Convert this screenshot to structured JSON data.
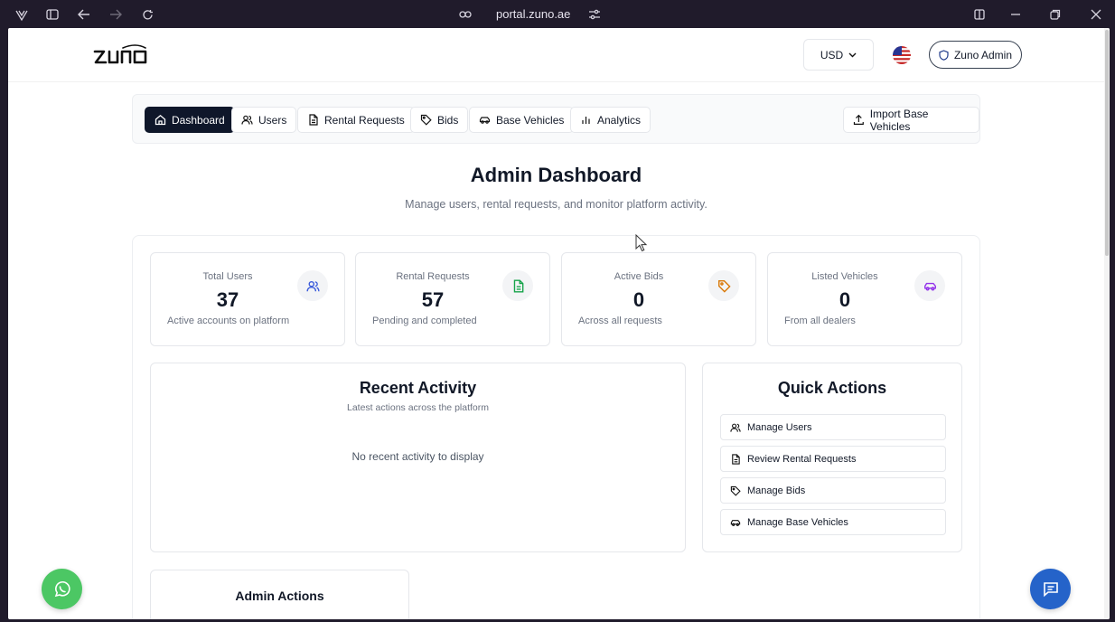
{
  "browser": {
    "url": "portal.zuno.ae"
  },
  "header": {
    "logo_text": "ZUNO",
    "currency": "USD",
    "admin_label": "Zuno Admin"
  },
  "nav": {
    "tabs": [
      {
        "label": "Dashboard",
        "icon": "home-icon",
        "active": true
      },
      {
        "label": "Users",
        "icon": "users-icon"
      },
      {
        "label": "Rental Requests",
        "icon": "document-icon"
      },
      {
        "label": "Bids",
        "icon": "tag-icon"
      },
      {
        "label": "Base Vehicles",
        "icon": "car-icon"
      },
      {
        "label": "Analytics",
        "icon": "bar-chart-icon"
      }
    ],
    "import_label": "Import Base Vehicles"
  },
  "page": {
    "title": "Admin Dashboard",
    "subtitle": "Manage users, rental requests, and monitor platform activity."
  },
  "stats": [
    {
      "label": "Total Users",
      "value": "37",
      "desc": "Active accounts on platform",
      "icon": "users-icon",
      "color": "#3b5bdb"
    },
    {
      "label": "Rental Requests",
      "value": "57",
      "desc": "Pending and completed",
      "icon": "document-icon",
      "color": "#16a34a"
    },
    {
      "label": "Active Bids",
      "value": "0",
      "desc": "Across all requests",
      "icon": "tag-icon",
      "color": "#d97706"
    },
    {
      "label": "Listed Vehicles",
      "value": "0",
      "desc": "From all dealers",
      "icon": "car-icon",
      "color": "#9333ea"
    }
  ],
  "recent": {
    "title": "Recent Activity",
    "subtitle": "Latest actions across the platform",
    "empty": "No recent activity to display"
  },
  "quick": {
    "title": "Quick Actions",
    "items": [
      {
        "label": "Manage Users",
        "icon": "users-icon"
      },
      {
        "label": "Review Rental Requests",
        "icon": "document-icon"
      },
      {
        "label": "Manage Bids",
        "icon": "tag-icon"
      },
      {
        "label": "Manage Base Vehicles",
        "icon": "car-icon"
      }
    ]
  },
  "admin_actions": {
    "title": "Admin Actions"
  }
}
